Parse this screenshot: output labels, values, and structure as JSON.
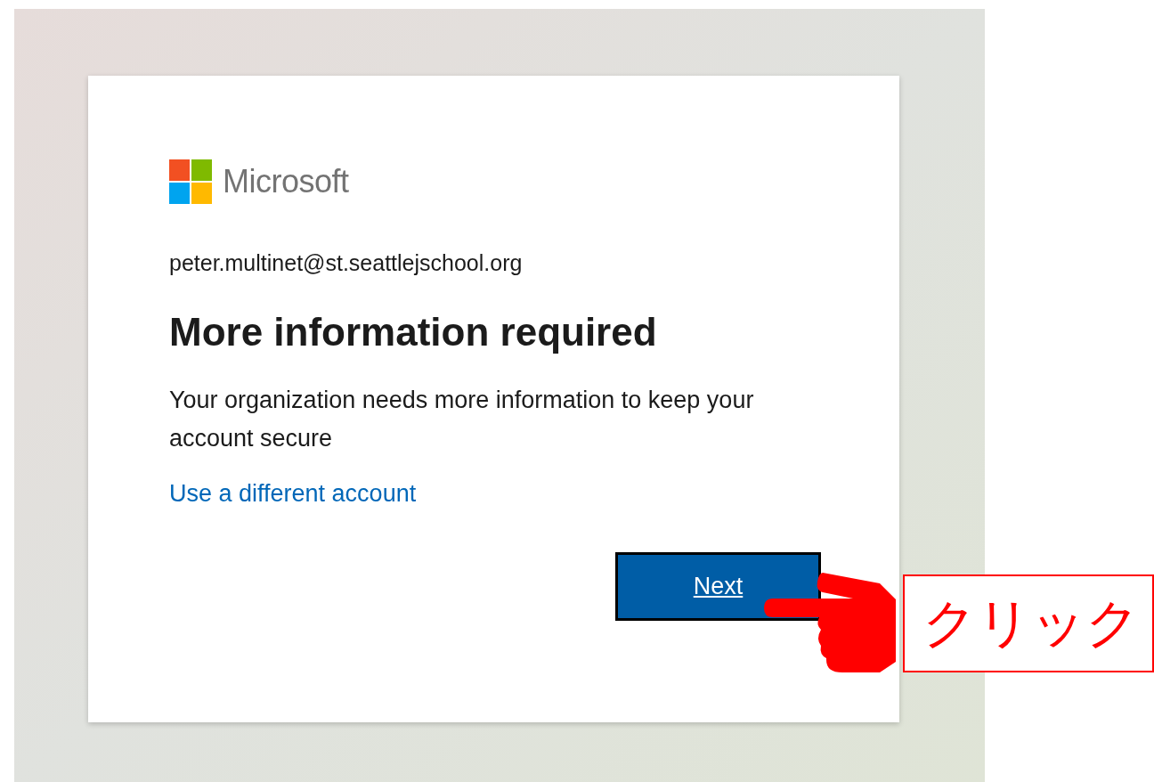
{
  "card": {
    "logo_text": "Microsoft",
    "account": "peter.multinet@st.seattlejschool.org",
    "title": "More information required",
    "message": "Your organization needs more information to keep your account secure",
    "link": "Use a different account",
    "button": "Next"
  },
  "annotation": {
    "label": "クリック"
  }
}
